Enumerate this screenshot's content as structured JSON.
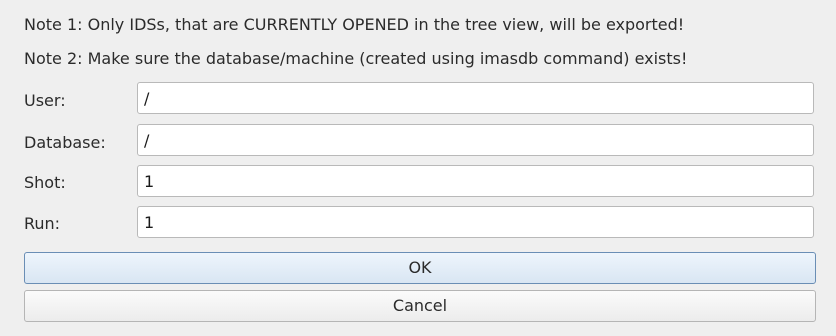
{
  "notes": {
    "note1": "Note 1: Only IDSs, that are CURRENTLY OPENED in the tree view, will be exported!",
    "note2": "Note 2: Make sure the database/machine (created using imasdb command) exists!"
  },
  "form": {
    "user": {
      "label": "User:",
      "value": "/"
    },
    "database": {
      "label": "Database:",
      "value": "/"
    },
    "shot": {
      "label": "Shot:",
      "value": "1"
    },
    "run": {
      "label": "Run:",
      "value": "1"
    }
  },
  "buttons": {
    "ok_label": "OK",
    "cancel_label": "Cancel"
  }
}
